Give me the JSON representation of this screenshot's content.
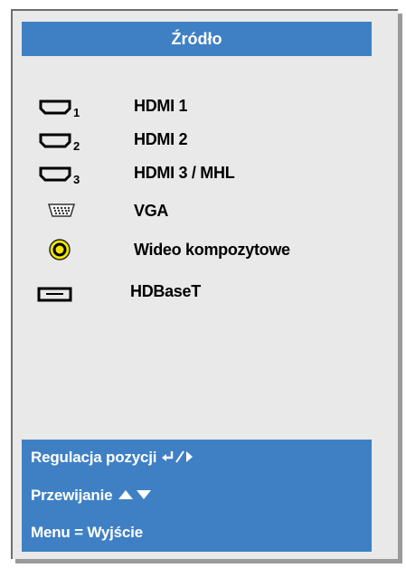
{
  "menu": {
    "title": "Źródło"
  },
  "sources": [
    {
      "label": "HDMI 1",
      "icon": "hdmi-1-icon",
      "subscript": "1"
    },
    {
      "label": "HDMI 2",
      "icon": "hdmi-2-icon",
      "subscript": "2"
    },
    {
      "label": "HDMI 3 / MHL",
      "icon": "hdmi-3-icon",
      "subscript": "3"
    },
    {
      "label": "VGA",
      "icon": "vga-port-icon"
    },
    {
      "label": "Wideo kompozytowe",
      "icon": "composite-rca-icon"
    },
    {
      "label": "HDBaseT",
      "icon": "hdbaset-port-icon"
    }
  ],
  "help": {
    "adjust_label": "Regulacja pozycji",
    "scroll_label": "Przewijanie",
    "exit_label": "Menu = Wyjście"
  },
  "colors": {
    "accent": "#3f80c4",
    "panel": "#e9e9e9",
    "rca_yellow": "#f2e600"
  }
}
